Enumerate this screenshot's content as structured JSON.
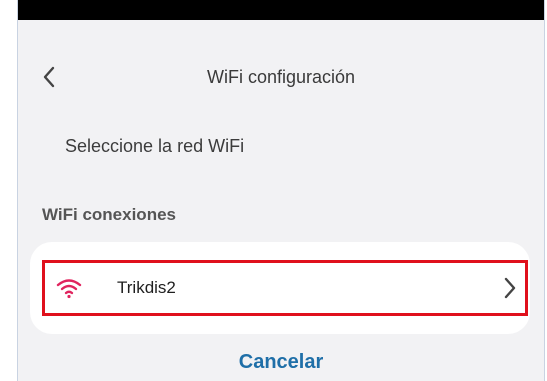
{
  "header": {
    "title": "WiFi configuración",
    "back_icon": "chevron-left-icon"
  },
  "subtitle": "Seleccione la red WiFi",
  "section": {
    "label": "WiFi conexiones"
  },
  "networks": [
    {
      "name": "Trikdis2",
      "icon": "wifi-icon",
      "icon_color": "#e0245e",
      "highlight_color": "#e0101c"
    }
  ],
  "actions": {
    "cancel_label": "Cancelar"
  },
  "colors": {
    "accent": "#1f6fa8",
    "background": "#f2f2f4",
    "status_bar": "#000000"
  }
}
